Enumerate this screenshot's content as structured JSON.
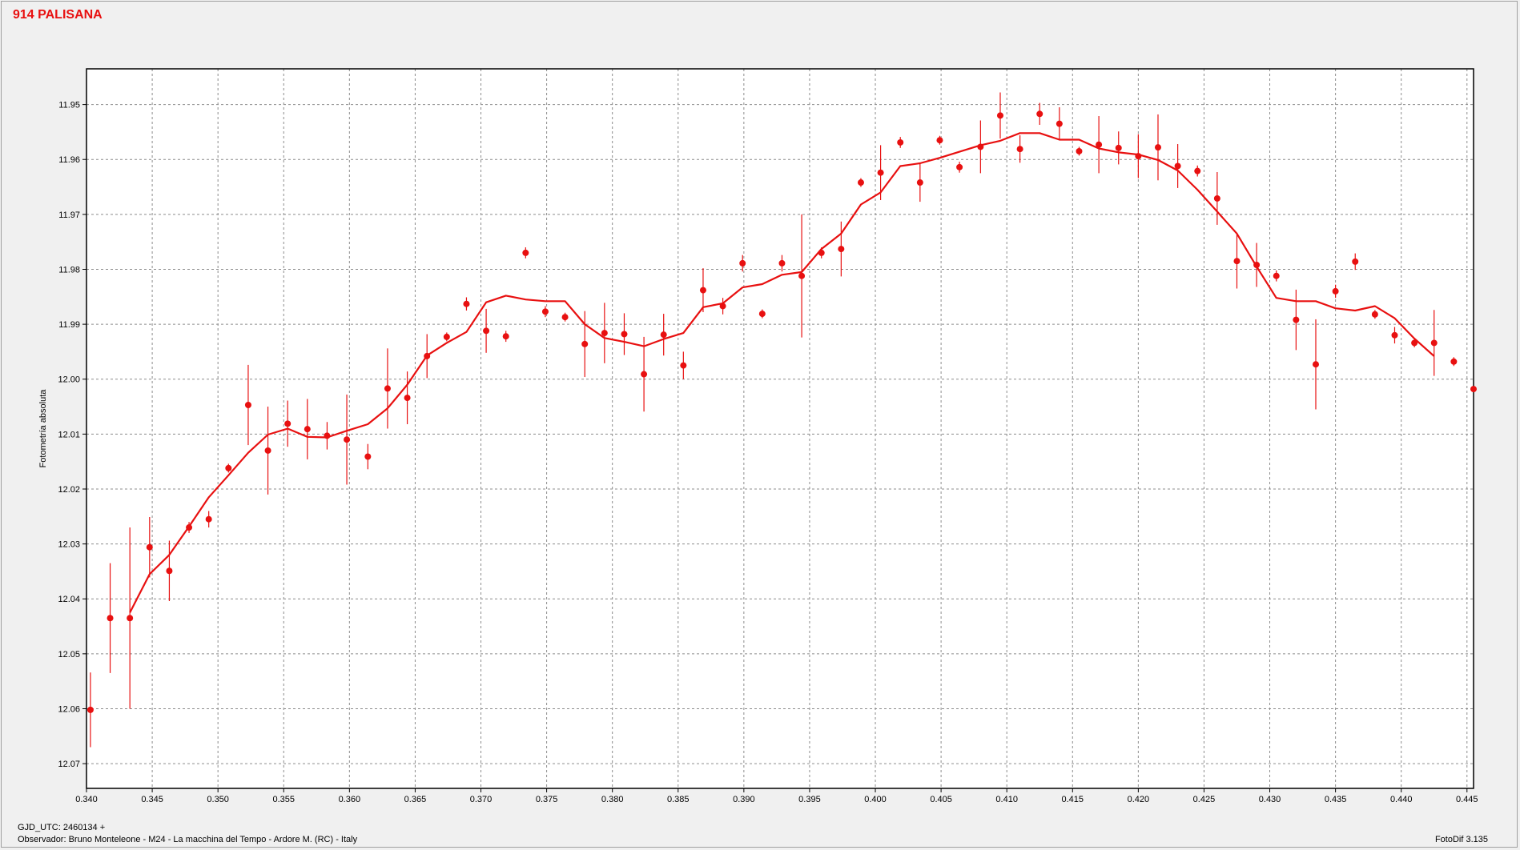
{
  "header": {
    "title": "914 PALISANA"
  },
  "footer": {
    "gjd": "GJD_UTC: 2460134 +",
    "observer": "Observador: Bruno Monteleone - M24 - La macchina del Tempo - Ardore M. (RC) - Italy",
    "software": "FotoDif 3.135"
  },
  "colors": {
    "series": "#e81010",
    "grid": "#8c8c8c",
    "plot_bg": "#ffffff",
    "window_bg": "#f0f0f0"
  },
  "chart_data": {
    "type": "scatter",
    "title": "914 PALISANA",
    "xlabel": "GJD_UTC: 2460134 +",
    "ylabel": "Fotometría absoluta",
    "xlim": [
      0.34,
      0.4455
    ],
    "ylim": [
      11.9435,
      12.0745
    ],
    "y_inverted": true,
    "grid": true,
    "x_ticks": [
      "0.340",
      "0.345",
      "0.350",
      "0.355",
      "0.360",
      "0.365",
      "0.370",
      "0.375",
      "0.380",
      "0.385",
      "0.390",
      "0.395",
      "0.400",
      "0.405",
      "0.410",
      "0.415",
      "0.420",
      "0.425",
      "0.430",
      "0.435",
      "0.440",
      "0.445"
    ],
    "y_ticks": [
      "11.95",
      "11.96",
      "11.97",
      "11.98",
      "11.99",
      "12.00",
      "12.01",
      "12.02",
      "12.03",
      "12.04",
      "12.05",
      "12.06",
      "12.07"
    ],
    "series": [
      {
        "kind": "points_with_error_bars",
        "points": [
          {
            "x": 0.3403,
            "y": 12.0602,
            "err": 0.0068
          },
          {
            "x": 0.3418,
            "y": 12.0435,
            "err": 0.01
          },
          {
            "x": 0.3433,
            "y": 12.0435,
            "err": 0.0165
          },
          {
            "x": 0.3448,
            "y": 12.0306,
            "err": 0.0055
          },
          {
            "x": 0.3463,
            "y": 12.0349,
            "err": 0.0055
          },
          {
            "x": 0.3478,
            "y": 12.027,
            "err": 0.001
          },
          {
            "x": 0.3493,
            "y": 12.0255,
            "err": 0.0015
          },
          {
            "x": 0.3508,
            "y": 12.0162,
            "err": 0.0008
          },
          {
            "x": 0.3523,
            "y": 12.0047,
            "err": 0.0073
          },
          {
            "x": 0.3538,
            "y": 12.013,
            "err": 0.008
          },
          {
            "x": 0.3553,
            "y": 12.0081,
            "err": 0.0042
          },
          {
            "x": 0.3568,
            "y": 12.0091,
            "err": 0.0055
          },
          {
            "x": 0.3583,
            "y": 12.0103,
            "err": 0.0025
          },
          {
            "x": 0.3598,
            "y": 12.011,
            "err": 0.0082
          },
          {
            "x": 0.3614,
            "y": 12.0141,
            "err": 0.0023
          },
          {
            "x": 0.3629,
            "y": 12.0017,
            "err": 0.0073
          },
          {
            "x": 0.3644,
            "y": 12.0034,
            "err": 0.0048
          },
          {
            "x": 0.3659,
            "y": 11.9958,
            "err": 0.004
          },
          {
            "x": 0.3674,
            "y": 11.9923,
            "err": 0.0008
          },
          {
            "x": 0.3689,
            "y": 11.9863,
            "err": 0.0012
          },
          {
            "x": 0.3704,
            "y": 11.9912,
            "err": 0.004
          },
          {
            "x": 0.3719,
            "y": 11.9922,
            "err": 0.001
          },
          {
            "x": 0.3734,
            "y": 11.977,
            "err": 0.001
          },
          {
            "x": 0.3749,
            "y": 11.9877,
            "err": 0.001
          },
          {
            "x": 0.3764,
            "y": 11.9887,
            "err": 0.0008
          },
          {
            "x": 0.3779,
            "y": 11.9936,
            "err": 0.006
          },
          {
            "x": 0.3794,
            "y": 11.9916,
            "err": 0.0055
          },
          {
            "x": 0.3809,
            "y": 11.9918,
            "err": 0.0038
          },
          {
            "x": 0.3824,
            "y": 11.9991,
            "err": 0.0068
          },
          {
            "x": 0.3839,
            "y": 11.9919,
            "err": 0.0038
          },
          {
            "x": 0.3854,
            "y": 11.9975,
            "err": 0.0025
          },
          {
            "x": 0.3869,
            "y": 11.9838,
            "err": 0.004
          },
          {
            "x": 0.3884,
            "y": 11.9867,
            "err": 0.0015
          },
          {
            "x": 0.3899,
            "y": 11.9789,
            "err": 0.0015
          },
          {
            "x": 0.3914,
            "y": 11.9881,
            "err": 0.0008
          },
          {
            "x": 0.3929,
            "y": 11.9789,
            "err": 0.0015
          },
          {
            "x": 0.3944,
            "y": 11.9812,
            "err": 0.0112
          },
          {
            "x": 0.3959,
            "y": 11.977,
            "err": 0.001
          },
          {
            "x": 0.3974,
            "y": 11.9763,
            "err": 0.005
          },
          {
            "x": 0.3989,
            "y": 11.9642,
            "err": 0.0008
          },
          {
            "x": 0.4004,
            "y": 11.9624,
            "err": 0.005
          },
          {
            "x": 0.4019,
            "y": 11.9569,
            "err": 0.001
          },
          {
            "x": 0.4034,
            "y": 11.9642,
            "err": 0.0035
          },
          {
            "x": 0.4049,
            "y": 11.9565,
            "err": 0.0008
          },
          {
            "x": 0.4064,
            "y": 11.9614,
            "err": 0.001
          },
          {
            "x": 0.408,
            "y": 11.9577,
            "err": 0.0048
          },
          {
            "x": 0.4095,
            "y": 11.952,
            "err": 0.0042
          },
          {
            "x": 0.411,
            "y": 11.9581,
            "err": 0.0025
          },
          {
            "x": 0.4125,
            "y": 11.9517,
            "err": 0.002
          },
          {
            "x": 0.414,
            "y": 11.9535,
            "err": 0.003
          },
          {
            "x": 0.4155,
            "y": 11.9585,
            "err": 0.0008
          },
          {
            "x": 0.417,
            "y": 11.9573,
            "err": 0.0052
          },
          {
            "x": 0.4185,
            "y": 11.9579,
            "err": 0.003
          },
          {
            "x": 0.42,
            "y": 11.9594,
            "err": 0.004
          },
          {
            "x": 0.4215,
            "y": 11.9578,
            "err": 0.006
          },
          {
            "x": 0.423,
            "y": 11.9612,
            "err": 0.004
          },
          {
            "x": 0.4245,
            "y": 11.9621,
            "err": 0.001
          },
          {
            "x": 0.426,
            "y": 11.9671,
            "err": 0.0048
          },
          {
            "x": 0.4275,
            "y": 11.9785,
            "err": 0.005
          },
          {
            "x": 0.429,
            "y": 11.9792,
            "err": 0.004
          },
          {
            "x": 0.4305,
            "y": 11.9812,
            "err": 0.001
          },
          {
            "x": 0.432,
            "y": 11.9892,
            "err": 0.0055
          },
          {
            "x": 0.4335,
            "y": 11.9973,
            "err": 0.0082
          },
          {
            "x": 0.435,
            "y": 11.984,
            "err": 0.0012
          },
          {
            "x": 0.4365,
            "y": 11.9786,
            "err": 0.0015
          },
          {
            "x": 0.438,
            "y": 11.9882,
            "err": 0.0008
          },
          {
            "x": 0.4395,
            "y": 11.992,
            "err": 0.0015
          },
          {
            "x": 0.441,
            "y": 11.9934,
            "err": 0.0008
          },
          {
            "x": 0.4425,
            "y": 11.9934,
            "err": 0.006
          },
          {
            "x": 0.444,
            "y": 11.9968,
            "err": 0.0008
          },
          {
            "x": 0.4455,
            "y": 12.0018,
            "err": 0.0005
          }
        ]
      },
      {
        "kind": "trend_line",
        "points": [
          [
            0.3433,
            12.0425
          ],
          [
            0.3448,
            12.0355
          ],
          [
            0.3463,
            12.032
          ],
          [
            0.3478,
            12.0268
          ],
          [
            0.3493,
            12.0215
          ],
          [
            0.3508,
            12.0175
          ],
          [
            0.3523,
            12.0134
          ],
          [
            0.3538,
            12.0101
          ],
          [
            0.3553,
            12.009
          ],
          [
            0.3568,
            12.0105
          ],
          [
            0.3583,
            12.0106
          ],
          [
            0.3598,
            12.0094
          ],
          [
            0.3614,
            12.0082
          ],
          [
            0.3629,
            12.0053
          ],
          [
            0.3644,
            12.001
          ],
          [
            0.3659,
            11.9957
          ],
          [
            0.3674,
            11.9934
          ],
          [
            0.3689,
            11.9914
          ],
          [
            0.3704,
            11.986
          ],
          [
            0.3719,
            11.9848
          ],
          [
            0.3734,
            11.9855
          ],
          [
            0.3749,
            11.9858
          ],
          [
            0.3764,
            11.9858
          ],
          [
            0.3779,
            11.99
          ],
          [
            0.3794,
            11.9925
          ],
          [
            0.3809,
            11.9932
          ],
          [
            0.3824,
            11.994
          ],
          [
            0.3839,
            11.9927
          ],
          [
            0.3854,
            11.9916
          ],
          [
            0.3869,
            11.9869
          ],
          [
            0.3884,
            11.9862
          ],
          [
            0.3899,
            11.9833
          ],
          [
            0.3914,
            11.9827
          ],
          [
            0.3929,
            11.981
          ],
          [
            0.3944,
            11.9805
          ],
          [
            0.3959,
            11.9763
          ],
          [
            0.3974,
            11.9735
          ],
          [
            0.3989,
            11.9682
          ],
          [
            0.4004,
            11.966
          ],
          [
            0.4019,
            11.9612
          ],
          [
            0.4034,
            11.9607
          ],
          [
            0.4049,
            11.9597
          ],
          [
            0.4064,
            11.9586
          ],
          [
            0.408,
            11.9574
          ],
          [
            0.4095,
            11.9566
          ],
          [
            0.411,
            11.9552
          ],
          [
            0.4125,
            11.9552
          ],
          [
            0.414,
            11.9564
          ],
          [
            0.4155,
            11.9564
          ],
          [
            0.417,
            11.958
          ],
          [
            0.4185,
            11.9587
          ],
          [
            0.42,
            11.9591
          ],
          [
            0.4215,
            11.9601
          ],
          [
            0.423,
            11.962
          ],
          [
            0.4245,
            11.9655
          ],
          [
            0.426,
            11.9695
          ],
          [
            0.4275,
            11.9735
          ],
          [
            0.429,
            11.9795
          ],
          [
            0.4305,
            11.9852
          ],
          [
            0.432,
            11.9858
          ],
          [
            0.4335,
            11.9858
          ],
          [
            0.435,
            11.9871
          ],
          [
            0.4365,
            11.9875
          ],
          [
            0.438,
            11.9867
          ],
          [
            0.4395,
            11.9889
          ],
          [
            0.441,
            11.9926
          ],
          [
            0.4425,
            11.9958
          ]
        ]
      }
    ]
  }
}
